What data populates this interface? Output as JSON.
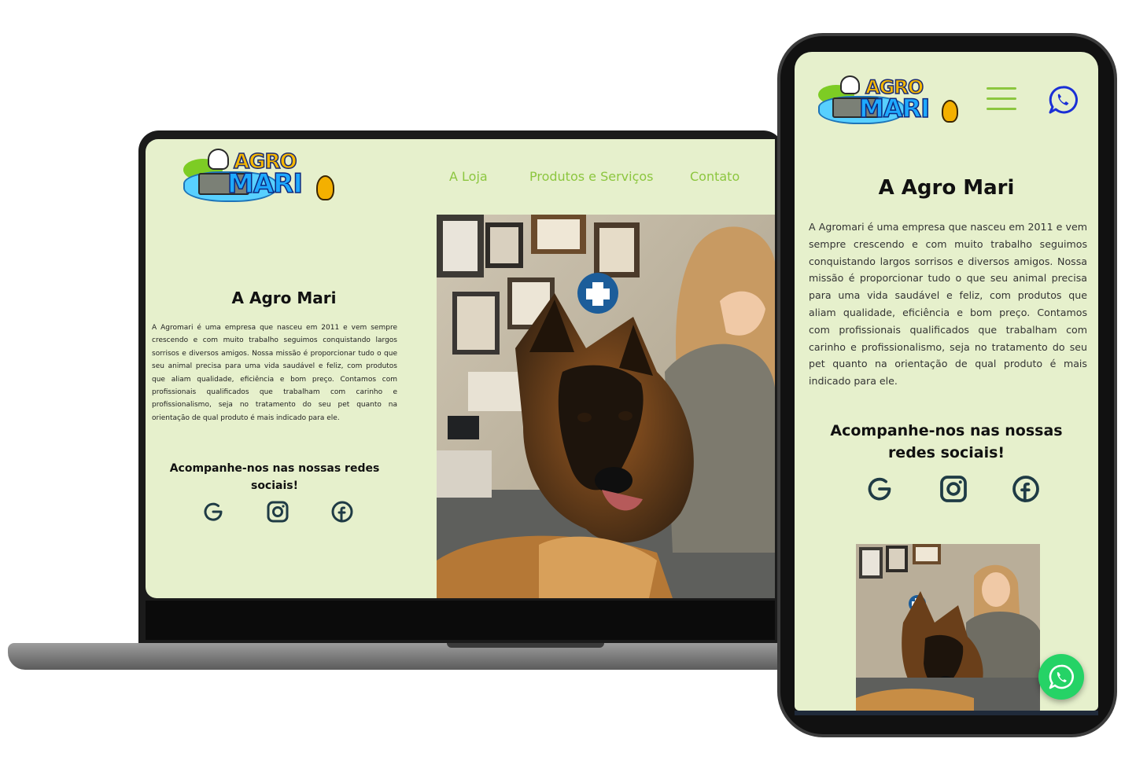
{
  "brand": {
    "logo_word1": "AGRO",
    "logo_word2": "MARI"
  },
  "nav": {
    "items": [
      "A Loja",
      "Produtos e Serviços",
      "Contato"
    ]
  },
  "about": {
    "title": "A Agro Mari",
    "paragraph": "A Agromari é uma empresa que nasceu em 2011 e vem sempre crescendo e com muito trabalho seguimos conquistando largos sorrisos e diversos amigos. Nossa missão é proporcionar tudo o que seu animal precisa para uma vida saudável e feliz, com produtos que aliam qualidade, eficiência e bom preço. Contamos com profissionais qualificados que trabalham com carinho e profissionalismo, seja no tratamento do seu pet quanto na orientação de qual produto é mais indicado para ele."
  },
  "social": {
    "title": "Acompanhe-nos nas nossas redes sociais!",
    "icons": [
      "google-icon",
      "instagram-icon",
      "facebook-icon"
    ]
  },
  "mobile_header": {
    "menu_icon": "hamburger-menu-icon",
    "whatsapp_icon": "whatsapp-icon"
  },
  "floating": {
    "icon": "whatsapp-icon"
  },
  "colors": {
    "page_background": "#e6f0cc",
    "nav_text": "#8cc63f",
    "hamburger": "#8cc63f",
    "whatsapp_header": "#1a2fd6",
    "whatsapp_float": "#25d366",
    "social_icon": "#1f3b45"
  }
}
